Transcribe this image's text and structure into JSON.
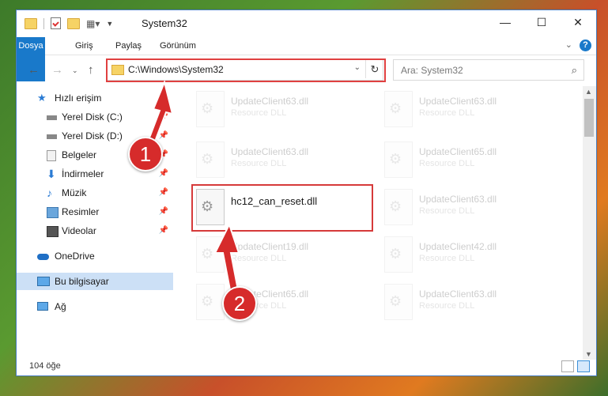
{
  "window": {
    "title": "System32",
    "controls": {
      "minimize": "—",
      "maximize": "☐",
      "close": "✕"
    }
  },
  "ribbon": {
    "tabs": [
      "Dosya",
      "Giriş",
      "Paylaş",
      "Görünüm"
    ],
    "help_label": "?"
  },
  "address": {
    "path": "C:\\Windows\\System32",
    "search_placeholder": "Ara: System32"
  },
  "sidebar": {
    "items": [
      {
        "label": "Hızlı erişim",
        "icon": "star-icon"
      },
      {
        "label": "Yerel Disk (C:)",
        "icon": "drive-icon"
      },
      {
        "label": "Yerel Disk (D:)",
        "icon": "drive-icon"
      },
      {
        "label": "Belgeler",
        "icon": "documents-icon"
      },
      {
        "label": "İndirmeler",
        "icon": "download-icon"
      },
      {
        "label": "Müzik",
        "icon": "music-icon"
      },
      {
        "label": "Resimler",
        "icon": "pictures-icon"
      },
      {
        "label": "Videolar",
        "icon": "video-icon"
      },
      {
        "label": "OneDrive",
        "icon": "cloud-icon"
      },
      {
        "label": "Bu bilgisayar",
        "icon": "computer-icon"
      },
      {
        "label": "Ağ",
        "icon": "network-icon"
      }
    ]
  },
  "files": {
    "left": [
      {
        "name": "UpdateClient63.dll",
        "type": "Resource DLL"
      },
      {
        "name": "UpdateClient63.dll",
        "type": "Resource DLL"
      },
      {
        "name": "hc12_can_reset.dll",
        "type": ""
      },
      {
        "name": "UpdateClient19.dll",
        "type": "Resource DLL"
      },
      {
        "name": "UpdateClient65.dll",
        "type": "Resource DLL"
      }
    ],
    "right": [
      {
        "name": "UpdateClient63.dll",
        "type": "Resource DLL"
      },
      {
        "name": "UpdateClient65.dll",
        "type": "Resource DLL"
      },
      {
        "name": "UpdateClient63.dll",
        "type": "Resource DLL"
      },
      {
        "name": "UpdateClient42.dll",
        "type": "Resource DLL"
      },
      {
        "name": "UpdateClient63.dll",
        "type": "Resource DLL"
      }
    ]
  },
  "status": {
    "count": "104 öğe"
  },
  "annotations": {
    "step1": "1",
    "step2": "2"
  },
  "colors": {
    "accent": "#1979ca",
    "highlight": "#e04040",
    "badge": "#d62b2b"
  }
}
